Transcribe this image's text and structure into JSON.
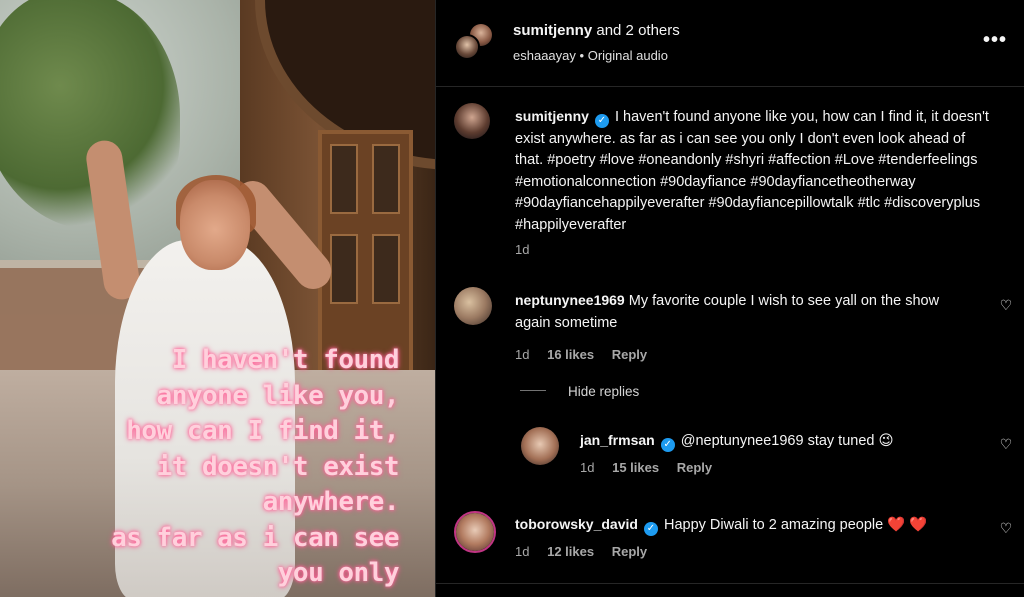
{
  "post_media": {
    "overlay_lines": [
      "I haven't found",
      "anyone like you,",
      "how can I find it,",
      "it doesn't exist",
      "anywhere.",
      "as far as i can see",
      "you only"
    ]
  },
  "header": {
    "title_user": "sumitjenny",
    "title_rest": "and 2 others",
    "sub_user": "eshaaayay",
    "sub_dot": "•",
    "sub_audio": "Original audio",
    "more_label": "•••"
  },
  "caption": {
    "username": "sumitjenny",
    "text": "I haven't found anyone like you, how can I find it, it doesn't exist anywhere. as far as i can see you only I don't even look ahead of that. #poetry #love #oneandonly #shyri #affection #Love #tenderfeelings #emotionalconnection #90dayfiance #90dayfiancetheotherway #90dayfiancehappilyeverafter #90dayfiancepillowtalk #tlc #discoveryplus #happilyeverafter",
    "time": "1d"
  },
  "comments": [
    {
      "username": "neptunynee1969",
      "text": "My favorite couple I wish to see yall on the show again sometime",
      "time": "1d",
      "likes": "16 likes",
      "reply": "Reply"
    },
    {
      "username": "jan_frmsan",
      "text": "@neptunynee1969 stay tuned 😉",
      "time": "1d",
      "likes": "15 likes",
      "reply": "Reply"
    },
    {
      "username": "toborowsky_david",
      "text": "Happy Diwali to 2 amazing people",
      "hearts": "❤️ ❤️",
      "time": "1d",
      "likes": "12 likes",
      "reply": "Reply"
    }
  ],
  "hide_replies_label": "Hide replies",
  "icons": {
    "like": "heart-icon",
    "verified": "verified-badge-icon",
    "more": "more-options-icon"
  },
  "colors": {
    "background": "#000000",
    "verified": "#1d9bf0",
    "heart_emoji": "#ff3040",
    "overlay_text": "#ffd0dc"
  }
}
